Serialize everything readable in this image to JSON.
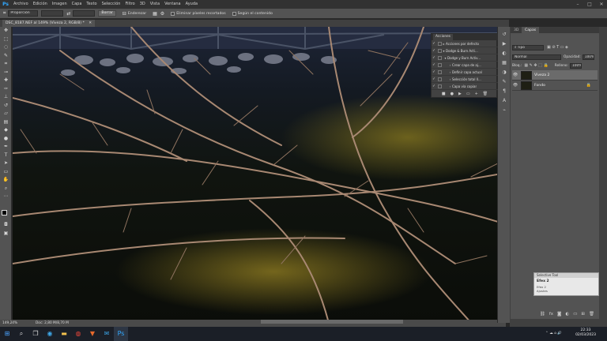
{
  "app": {
    "logo": "Ps"
  },
  "menu": [
    "Archivo",
    "Edición",
    "Imagen",
    "Capa",
    "Texto",
    "Selección",
    "Filtro",
    "3D",
    "Vista",
    "Ventana",
    "Ayuda"
  ],
  "options": {
    "mode_value": "Proporción",
    "clear_button": "Borrar",
    "straighten_label": "Enderezar",
    "delete_pixels_label": "Eliminar píxeles recortados",
    "content_aware_label": "Según el contenido"
  },
  "document": {
    "tab_title": "DSC_8187.NEF al 149% (Viveza 2, RGB/8) *"
  },
  "status": {
    "zoom": "149,24%",
    "doc_size": "Doc: 2,80 M/8,70 M"
  },
  "layers": {
    "tab_3d": "3D",
    "tab_layers": "Capas",
    "filter_kind": "Tipo",
    "blend_mode": "Normal",
    "opacity_label": "Opacidad:",
    "opacity_value": "100%",
    "lock_label": "Bloq.:",
    "fill_label": "Relleno:",
    "fill_value": "100%",
    "items": [
      {
        "name": "Viveza 2",
        "selected": true
      },
      {
        "name": "Fondo",
        "selected": false,
        "locked": true
      }
    ]
  },
  "actions": {
    "tab": "Acciones",
    "rows": [
      {
        "label": "Acciones por defecto",
        "level": 0
      },
      {
        "label": "Dodge & Burn Acti...",
        "level": 0
      },
      {
        "label": "Dodge y Burn Activ...",
        "level": 1
      },
      {
        "label": "Crear capa de aj...",
        "level": 2
      },
      {
        "label": "Definir capa actual",
        "level": 2
      },
      {
        "label": "Selección total ll...",
        "level": 2
      },
      {
        "label": "Capa vía copiar",
        "level": 2
      }
    ]
  },
  "selective_tool": {
    "header": "Selective Tool",
    "title": "Efex 2",
    "line1": "Efex 2",
    "line2": "Ajustes"
  },
  "clock": {
    "time": "22:33",
    "date": "02/03/2023"
  },
  "colors": {
    "accent": "#31a8ff",
    "panel": "#535353",
    "dark": "#282828"
  }
}
